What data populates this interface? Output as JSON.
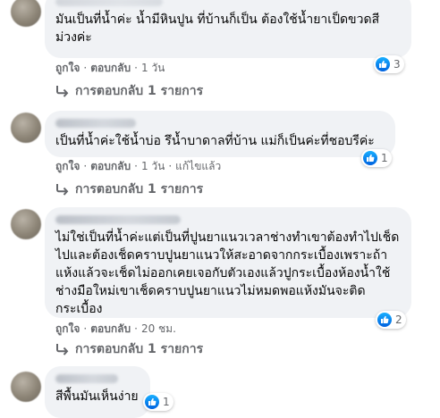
{
  "comments": [
    {
      "text": "มันเป็นที่น้ำค่ะ น้ำมีหินปูน ที่บ้านก็เป็น ต้องใช้น้ำยาเป็ดขวดสีม่วงค่ะ",
      "like_label": "ถูกใจ",
      "reply_label": "ตอบกลับ",
      "time": "1 วัน",
      "reaction_count": "3",
      "replies_label": "การตอบกลับ 1 รายการ"
    },
    {
      "text": "เป็นที่น้ำค่ะใช้น้ำบ่อ รึน้ำบาดาลที่บ้าน แม่ก็เป็นค่ะที่ชอบรีค่ะ",
      "like_label": "ถูกใจ",
      "reply_label": "ตอบกลับ",
      "time": "1 วัน",
      "edited_label": "แก้ไขแล้ว",
      "reaction_count": "1",
      "replies_label": "การตอบกลับ 1 รายการ"
    },
    {
      "text": "ไม่ใช่เป็นที่น้ำค่ะแต่เป็นที่ปูนยาแนวเวลาช่างทำเขาต้องทำไปเช็ดไปและต้องเช็ดคราบปูนยาแนวให้สะอาดจากกระเบื้องเพราะถ้าแห้งแล้วจะเช็ดไม่ออกเคยเจอกับตัวเองแล้วปูกระเบื้องห้องน้ำใช้ช่างมือใหม่เขาเช็ดคราบปูนยาแนวไม่หมดพอแห้งมันจะติดกระเบื้อง",
      "like_label": "ถูกใจ",
      "reply_label": "ตอบกลับ",
      "time": "20 ชม.",
      "reaction_count": "2",
      "replies_label": "การตอบกลับ 1 รายการ"
    },
    {
      "text": "สีพื้นมันเห็นง่าย",
      "reaction_count": "1"
    }
  ],
  "colors": {
    "bubble": "#f0f2f5",
    "secondary_text": "#65676b",
    "like_blue": "#1877f2"
  },
  "icons": [
    "like-icon",
    "reply-arrow-icon"
  ]
}
